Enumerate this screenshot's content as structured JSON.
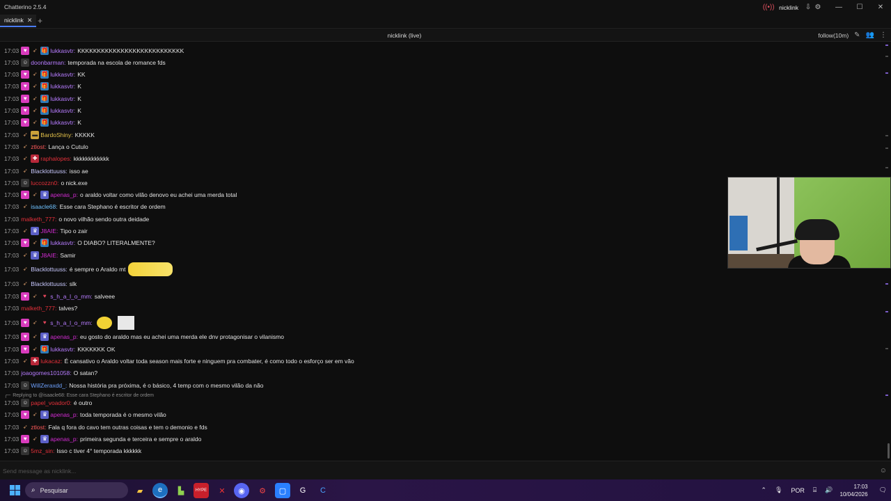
{
  "window": {
    "title": "Chatterino 2.5.4",
    "user": "nicklink",
    "icons": [
      "live-icon",
      "download-icon",
      "settings-icon"
    ],
    "controls": [
      "minimize",
      "maximize",
      "close"
    ]
  },
  "tabs": [
    {
      "label": "nicklink"
    }
  ],
  "split": {
    "title": "nicklink (live)",
    "mode_label": "follow(10m)"
  },
  "input": {
    "placeholder": "Send message as nicklink..."
  },
  "messages": [
    {
      "time": "17:03",
      "badges": [
        "sub",
        "bits",
        "gift"
      ],
      "user": "lukkasvtr",
      "color": "#b77cff",
      "text": "KKKKKKKKKKKKKKKKKKKKKKKKKKK"
    },
    {
      "time": "17:03",
      "badges": [
        "dark"
      ],
      "user": "doonbarman",
      "color": "#b77cff",
      "text": "temporada na escola de romance fds"
    },
    {
      "time": "17:03",
      "badges": [
        "sub",
        "bits",
        "gift"
      ],
      "user": "lukkasvtr",
      "color": "#b77cff",
      "text": "KK"
    },
    {
      "time": "17:03",
      "badges": [
        "sub",
        "bits",
        "gift"
      ],
      "user": "lukkasvtr",
      "color": "#b77cff",
      "text": "K"
    },
    {
      "time": "17:03",
      "badges": [
        "sub",
        "bits",
        "gift"
      ],
      "user": "lukkasvtr",
      "color": "#b77cff",
      "text": "K"
    },
    {
      "time": "17:03",
      "badges": [
        "sub",
        "bits",
        "gift"
      ],
      "user": "lukkasvtr",
      "color": "#b77cff",
      "text": "K"
    },
    {
      "time": "17:03",
      "badges": [
        "sub",
        "bits",
        "gift"
      ],
      "user": "lukkasvtr",
      "color": "#b77cff",
      "text": "K"
    },
    {
      "time": "17:03",
      "badges": [
        "bits",
        "gold"
      ],
      "user": "BardoShiny",
      "color": "#e5c24a",
      "text": "KKKKK"
    },
    {
      "time": "17:03",
      "badges": [
        "bits"
      ],
      "user": "ztlost",
      "color": "#ff5a5a",
      "text": "Lança o Cutulo"
    },
    {
      "time": "17:03",
      "badges": [
        "bits",
        "red"
      ],
      "user": "raphalopes",
      "color": "#e5303a",
      "text": "kkkkkkkkkkkk"
    },
    {
      "time": "17:03",
      "badges": [
        "bits"
      ],
      "user": "Blacklottuuss",
      "color": "#c9c9ff",
      "text": "isso ae"
    },
    {
      "time": "17:03",
      "badges": [
        "dark"
      ],
      "user": "luccozzn0",
      "color": "#e5303a",
      "text": "o nick.exe"
    },
    {
      "time": "17:03",
      "badges": [
        "sub",
        "bits",
        "prime"
      ],
      "user": "apenas_p",
      "color": "#d22bd2",
      "text": "o araldo voltar como vilão denovo eu achei uma merda total"
    },
    {
      "time": "17:03",
      "badges": [
        "bits"
      ],
      "user": "isaacle68",
      "color": "#6fc2ff",
      "text": "Esse cara Stephano é escritor de ordem"
    },
    {
      "time": "17:03",
      "badges": [],
      "user": "malketh_777",
      "color": "#e5303a",
      "text": "o novo vilhão sendo outra deidade"
    },
    {
      "time": "17:03",
      "badges": [
        "bits",
        "prime"
      ],
      "user": "J8AIE",
      "color": "#d22bd2",
      "text": "Tipo o zair"
    },
    {
      "time": "17:03",
      "badges": [
        "sub",
        "bits",
        "gift"
      ],
      "user": "lukkasvtr",
      "color": "#b77cff",
      "text": "O DIABO? LITERALMENTE?"
    },
    {
      "time": "17:03",
      "badges": [
        "bits",
        "prime"
      ],
      "user": "J8AIE",
      "color": "#d22bd2",
      "text": "Samir"
    },
    {
      "time": "17:03",
      "badges": [
        "bits"
      ],
      "user": "Blacklottuuss",
      "color": "#c9c9ff",
      "text": "é sempre o Araldo mt",
      "emote": "pato"
    },
    {
      "time": "17:03",
      "badges": [
        "bits"
      ],
      "user": "Blacklottuuss",
      "color": "#c9c9ff",
      "text": "slk"
    },
    {
      "time": "17:03",
      "badges": [
        "sub",
        "bits",
        "heart"
      ],
      "user": "s_h_a_l_o_mm",
      "color": "#b77cff",
      "text": "salveee"
    },
    {
      "time": "17:03",
      "badges": [],
      "user": "malketh_777",
      "color": "#e5303a",
      "text": "talves?"
    },
    {
      "time": "17:03",
      "badges": [
        "sub",
        "bits",
        "heart"
      ],
      "user": "s_h_a_l_o_mm",
      "color": "#b77cff",
      "text": "",
      "emote": "smiley"
    },
    {
      "time": "17:03",
      "badges": [
        "sub",
        "bits",
        "prime"
      ],
      "user": "apenas_p",
      "color": "#d22bd2",
      "text": "eu gosto do araldo mas eu achei uma merda ele dnv protagonisar o vilanismo"
    },
    {
      "time": "17:03",
      "badges": [
        "sub",
        "bits",
        "gift"
      ],
      "user": "lukkasvtr",
      "color": "#b77cff",
      "text": "KKKKKKK OK"
    },
    {
      "time": "17:03",
      "badges": [
        "bits",
        "red"
      ],
      "user": "lukacaz",
      "color": "#e5303a",
      "text": "É cansativo o Araldo voltar toda season mais forte e ninguem pra combater, é como todo o esforço ser em vão"
    },
    {
      "time": "17:03",
      "badges": [],
      "user": "joaogomes101058",
      "color": "#b77cff",
      "text": "O satan?"
    },
    {
      "time": "17:03",
      "badges": [
        "dark"
      ],
      "user": "WillZeraxdd_",
      "color": "#6fa2ff",
      "text": "Nossa história pra próxima, é o básico, 4 temp com o mesmo vilão da não"
    },
    {
      "time": "17:03",
      "badges": [
        "dark"
      ],
      "user": "papel_voador0",
      "color": "#e5303a",
      "text": "é outro",
      "reply": "Replying to @isaacle68: Esse cara Stephano é escritor de ordem"
    },
    {
      "time": "17:03",
      "badges": [
        "sub",
        "bits",
        "prime"
      ],
      "user": "apenas_p",
      "color": "#d22bd2",
      "text": "toda temporada é o mesmo vilão"
    },
    {
      "time": "17:03",
      "badges": [
        "bits"
      ],
      "user": "ztlost",
      "color": "#ff5a5a",
      "text": "Fala q fora do cavo tem outras coisas e tem o demonio e fds"
    },
    {
      "time": "17:03",
      "badges": [
        "sub",
        "bits",
        "prime"
      ],
      "user": "apenas_p",
      "color": "#d22bd2",
      "text": "primeira segunda e terceira e sempre o araldo"
    },
    {
      "time": "17:03",
      "badges": [
        "dark"
      ],
      "user": "5mz_sin",
      "color": "#e5303a",
      "text": "Isso c tiver 4° temporada kkkkkk"
    }
  ],
  "taskbar": {
    "search_label": "Pesquisar",
    "language": "POR",
    "time": "17:03",
    "date": "10/04/2026",
    "apps": [
      "file-explorer",
      "edge",
      "app-green",
      "app-hype",
      "app-x",
      "discord",
      "app-red",
      "app-blue",
      "app-g",
      "chatterino"
    ]
  }
}
